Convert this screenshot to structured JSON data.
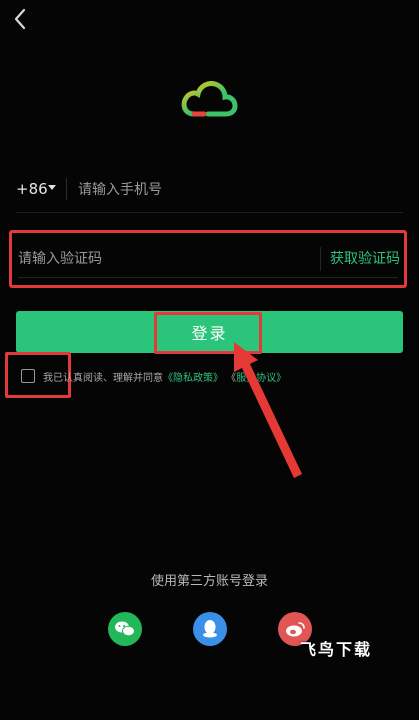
{
  "phone": {
    "country_code": "+86",
    "placeholder": "请输入手机号"
  },
  "verify": {
    "placeholder": "请输入验证码",
    "get_code_label": "获取验证码"
  },
  "login": {
    "label": "登录"
  },
  "agreement": {
    "prefix": "我已认真阅读、理解并同意",
    "privacy_link": "《隐私政策》",
    "middle": " 《",
    "user_link": "服务协议》"
  },
  "third_party": {
    "title": "使用第三方账号登录"
  },
  "watermark": "飞鸟下载",
  "colors": {
    "accent": "#2ac57a",
    "highlight": "#e03a3a",
    "logo_yellow": "#f5c518",
    "logo_green": "#3cc36a",
    "logo_red": "#e4463b"
  }
}
